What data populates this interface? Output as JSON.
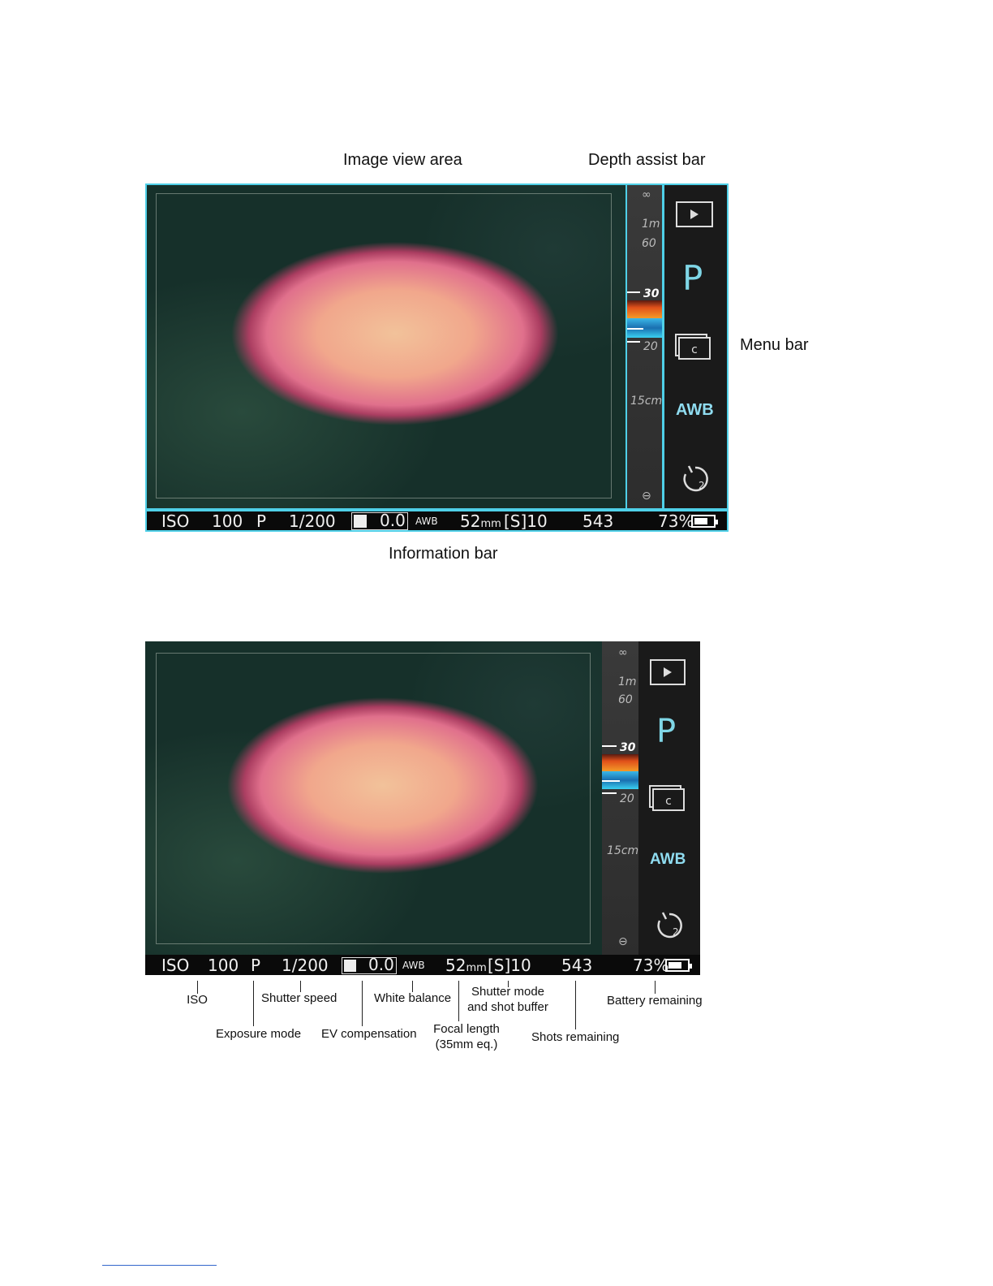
{
  "top_labels": {
    "image_view_area": "Image view area",
    "depth_assist_bar": "Depth assist bar",
    "menu_bar": "Menu bar",
    "information_bar": "Information bar"
  },
  "depth_scale": {
    "infinity": "∞",
    "m1": "1m",
    "d60": "60",
    "d30": "30",
    "d20": "20",
    "cm15": "15cm",
    "near": "⊖"
  },
  "menu": {
    "mode": "P",
    "wb": "AWB"
  },
  "info_bar": {
    "iso_label": "ISO",
    "iso_value": "100",
    "mode": "P",
    "shutter": "1/200",
    "ev": "0.0",
    "wb": "AWB",
    "focal": "52",
    "focal_unit": "mm",
    "shutter_mode": "[S]10",
    "shots": "543",
    "battery": "73%"
  },
  "battery_level": 0.73,
  "callouts": {
    "iso": "ISO",
    "shutter_speed": "Shutter speed",
    "white_balance": "White balance",
    "shutter_mode_1": "Shutter mode",
    "shutter_mode_2": "and shot buffer",
    "battery_remaining": "Battery remaining",
    "exposure_mode": "Exposure mode",
    "ev_comp": "EV compensation",
    "focal_1": "Focal length",
    "focal_2": "(35mm eq.)",
    "shots_remaining": "Shots remaining"
  }
}
